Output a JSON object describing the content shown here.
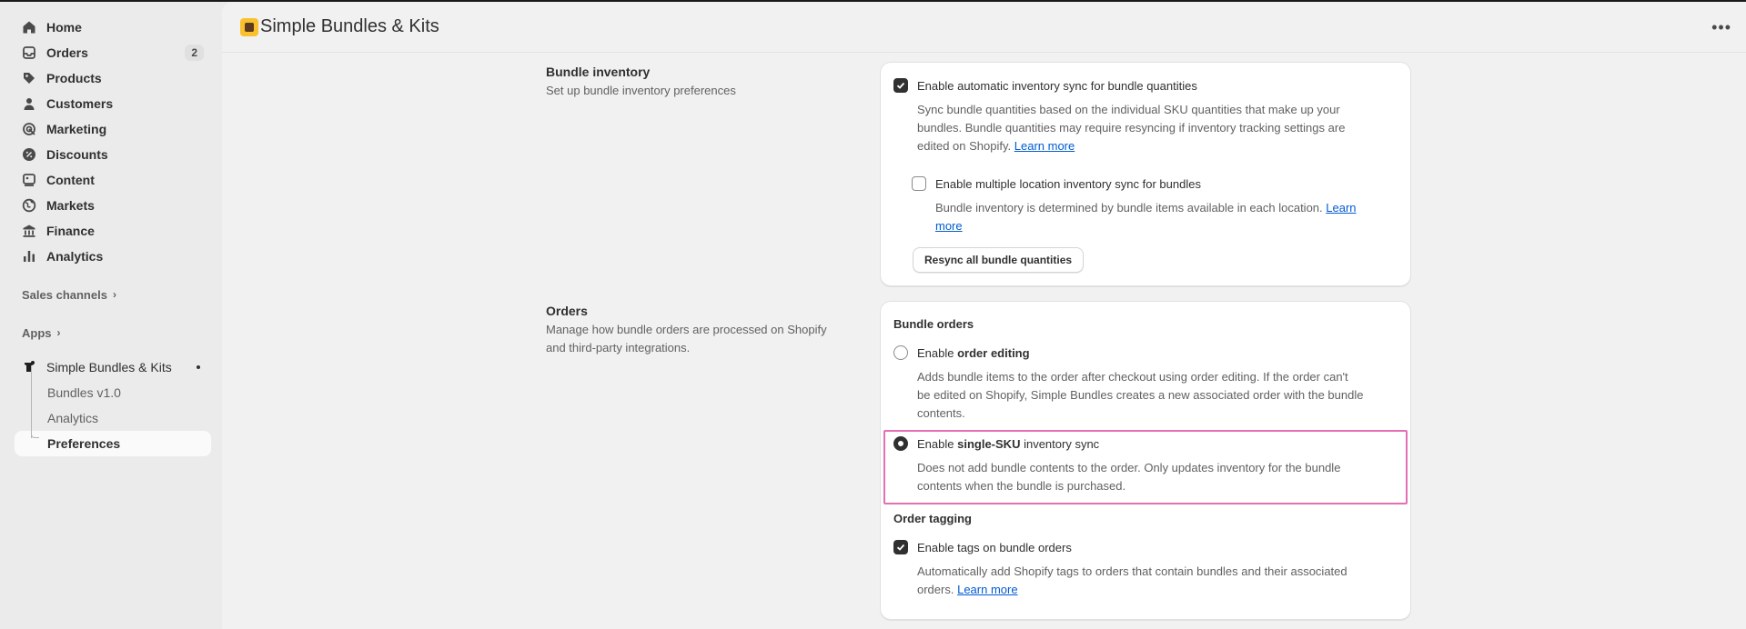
{
  "sidebar": {
    "items": [
      {
        "label": "Home",
        "icon": "home-icon"
      },
      {
        "label": "Orders",
        "icon": "inbox-icon",
        "badge": "2"
      },
      {
        "label": "Products",
        "icon": "tag-icon"
      },
      {
        "label": "Customers",
        "icon": "person-icon"
      },
      {
        "label": "Marketing",
        "icon": "target-icon"
      },
      {
        "label": "Discounts",
        "icon": "discount-icon"
      },
      {
        "label": "Content",
        "icon": "content-icon"
      },
      {
        "label": "Markets",
        "icon": "globe-icon"
      },
      {
        "label": "Finance",
        "icon": "bank-icon"
      },
      {
        "label": "Analytics",
        "icon": "bar-chart-icon"
      }
    ],
    "sales_channels": "Sales channels",
    "apps": "Apps",
    "app_name": "Simple Bundles & Kits",
    "app_sub_items": [
      "Bundles v1.0",
      "Analytics",
      "Preferences"
    ]
  },
  "header": {
    "title": "Simple Bundles & Kits"
  },
  "inventory": {
    "title": "Bundle inventory",
    "description": "Set up bundle inventory preferences",
    "auto_sync_label": "Enable automatic inventory sync for bundle quantities",
    "auto_sync_help_1": "Sync bundle quantities based on the individual SKU quantities that make up your",
    "auto_sync_help_2": "bundles. Bundle quantities may require resyncing if inventory tracking settings are",
    "auto_sync_help_3": "edited on Shopify.",
    "learn_more": "Learn more",
    "multi_label": "Enable multiple location inventory sync for bundles",
    "multi_help_1": "Bundle inventory is determined by bundle items available in each location.",
    "multi_learn": "Learn",
    "multi_more": "more",
    "resync_button": "Resync all bundle quantities"
  },
  "orders": {
    "title": "Orders",
    "description_1": "Manage how bundle orders are processed on Shopify",
    "description_2": "and third-party integrations.",
    "bundle_orders_head": "Bundle orders",
    "opt1_prefix": "Enable",
    "opt1_bold": "order editing",
    "opt1_help_1": "Adds bundle items to the order after checkout using order editing. If the order can't",
    "opt1_help_2": "be edited on Shopify, Simple Bundles creates a new associated order with the bundle",
    "opt1_help_3": "contents.",
    "opt2_prefix": "Enable",
    "opt2_bold": "single-SKU",
    "opt2_suffix": "inventory sync",
    "opt2_help_1": "Does not add bundle contents to the order. Only updates inventory for the bundle",
    "opt2_help_2": "contents when the bundle is purchased.",
    "tagging_head": "Order tagging",
    "tags_label": "Enable tags on bundle orders",
    "tags_help_1": "Automatically add Shopify tags to orders that contain bundles and their associated",
    "tags_help_2": "orders.",
    "tags_learn_more": "Learn more"
  },
  "colors": {
    "highlight": "#e46fb4",
    "link": "#005bd3"
  }
}
